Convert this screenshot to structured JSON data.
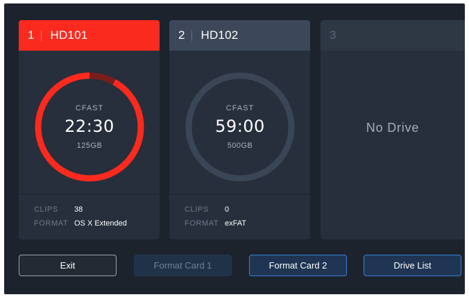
{
  "colors": {
    "recording_red": "#fb2a1f",
    "ring_track_dark_red": "#7a1e1c",
    "ring_idle": "#3a4555",
    "accent_blue": "#3a82d6",
    "panel": "#262f3b",
    "background": "#1c232c"
  },
  "slots": [
    {
      "number": "1",
      "name": "HD101",
      "media_type": "CFAST",
      "time_remaining": "22:30",
      "capacity": "125GB",
      "clips_label": "CLIPS",
      "clips": "38",
      "format_label": "FORMAT",
      "format": "OS X Extended",
      "used_fraction": 0.08,
      "active": true
    },
    {
      "number": "2",
      "name": "HD102",
      "media_type": "CFAST",
      "time_remaining": "59:00",
      "capacity": "500GB",
      "clips_label": "CLIPS",
      "clips": "0",
      "format_label": "FORMAT",
      "format": "exFAT",
      "used_fraction": 0,
      "active": false
    },
    {
      "number": "3",
      "status": "No Drive"
    }
  ],
  "buttons": {
    "exit": "Exit",
    "format_card_1": "Format Card 1",
    "format_card_2": "Format Card 2",
    "drive_list": "Drive List"
  }
}
